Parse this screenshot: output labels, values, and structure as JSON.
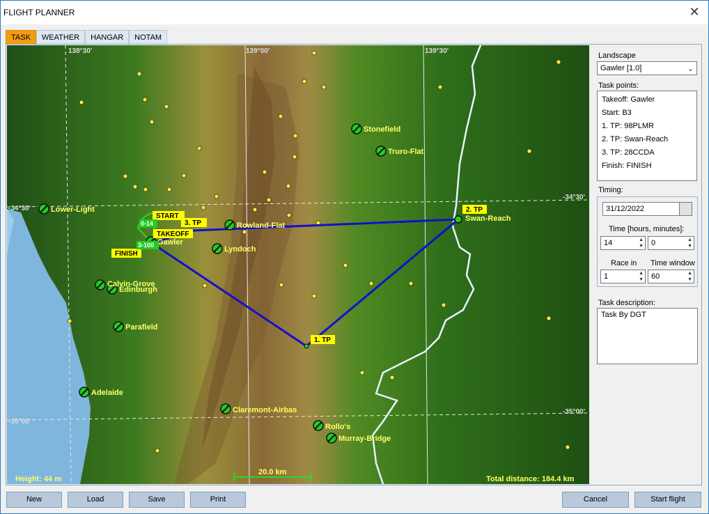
{
  "window": {
    "title": "FLIGHT PLANNER",
    "close_glyph": "✕"
  },
  "tabs": [
    {
      "label": "TASK",
      "active": true
    },
    {
      "label": "WEATHER",
      "active": false
    },
    {
      "label": "HANGAR",
      "active": false
    },
    {
      "label": "NOTAM",
      "active": false
    }
  ],
  "map": {
    "lon_labels": [
      "138°30'",
      "139°00'",
      "139°30'"
    ],
    "lat_labels": [
      "-34°30'",
      "-35°00'"
    ],
    "places": [
      "Stonefield",
      "Truro-Flat",
      "Lower-Light",
      "Rowland-Flat",
      "Lyndoch",
      "Gawler",
      "Calvin-Grove",
      "Edinburgh",
      "Parafield",
      "Adelaide",
      "Claremont-Airbas",
      "Rollo's",
      "Murray-Bridge",
      "Swan-Reach"
    ],
    "task_tags": {
      "start": "START",
      "tp3": "3. TP",
      "takeoff": "TAKEOFF",
      "finish": "FINISH",
      "tp2": "2. TP",
      "tp1": "1. TP"
    },
    "sector_labels": {
      "top": "0-14",
      "bottom": "3-100"
    },
    "height": "Height: 44 m",
    "scale": "20.0 km",
    "total_distance": "Total distance: 184.4 km"
  },
  "side": {
    "landscape_label": "Landscape",
    "landscape_value": "Gawler [1.0]",
    "task_points_label": "Task points:",
    "task_points": [
      "Takeoff: Gawler",
      "Start: B3",
      "1. TP: 98PLMR",
      "2. TP: Swan-Reach",
      "3. TP: 28CCDA",
      "Finish: FINISH"
    ],
    "timing_label": "Timing:",
    "date": "31/12/2022",
    "time_label": "Time [hours, minutes]:",
    "hours": "14",
    "minutes": "0",
    "race_in_label": "Race in",
    "time_window_label": "Time window",
    "race_in": "1",
    "time_window": "60",
    "description_label": "Task description:",
    "description": "Task By DGT"
  },
  "buttons": {
    "new": "New",
    "load": "Load",
    "save": "Save",
    "print": "Print",
    "cancel": "Cancel",
    "start_flight": "Start flight"
  },
  "icons": {
    "dropdown": "chevron-down-icon",
    "spin": "spin-arrows-icon",
    "calendar": "calendar-icon"
  },
  "colors": {
    "active_tab": "#f39c12",
    "route": "#1010cc",
    "tag_bg": "#ffff00",
    "waypoint": "#22cc22",
    "map_label": "#ffff66"
  }
}
